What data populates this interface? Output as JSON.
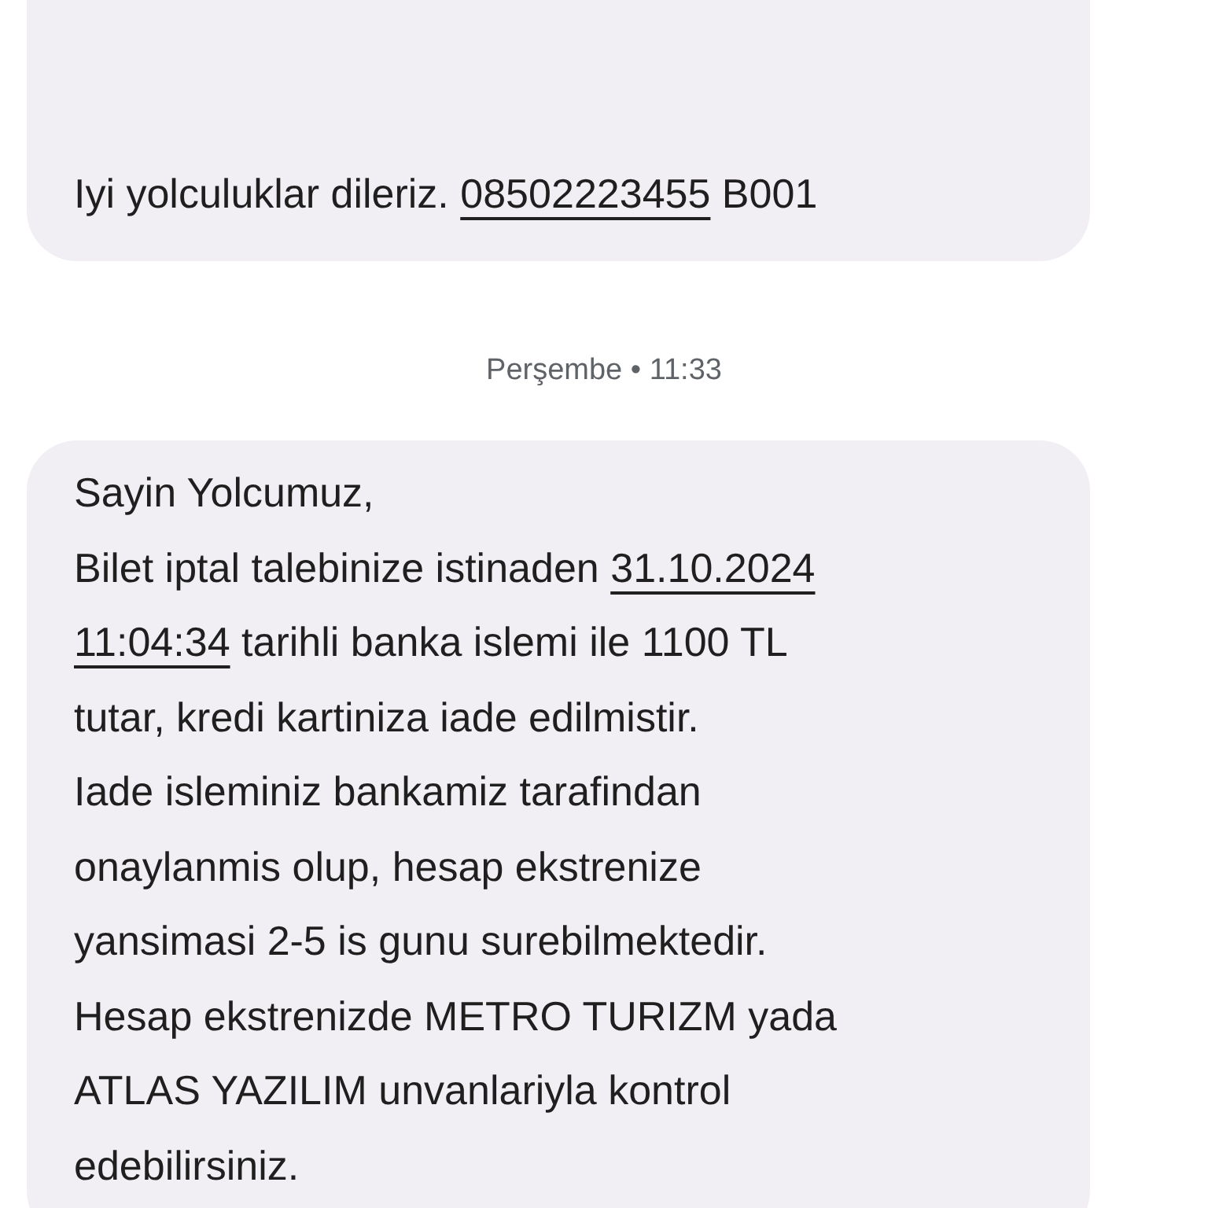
{
  "messages": [
    {
      "lines": [
        [
          {
            "kind": "text",
            "text": "Iyi yolculuklar dileriz. "
          },
          {
            "kind": "phone",
            "text": "08502223455"
          },
          {
            "kind": "text",
            "text": " B001"
          }
        ]
      ]
    },
    {
      "timestamp": "Perşembe • 11:33",
      "lines": [
        [
          {
            "kind": "text",
            "text": "Sayin Yolcumuz,"
          }
        ],
        [
          {
            "kind": "text",
            "text": "Bilet iptal talebinize istinaden "
          },
          {
            "kind": "date",
            "text": "31.10.2024"
          }
        ],
        [
          {
            "kind": "date",
            "text": "11:04:34"
          },
          {
            "kind": "text",
            "text": " tarihli banka islemi ile 1100 TL"
          }
        ],
        [
          {
            "kind": "text",
            "text": "tutar, kredi kartiniza iade edilmistir."
          }
        ],
        [
          {
            "kind": "text",
            "text": "Iade isleminiz bankamiz tarafindan"
          }
        ],
        [
          {
            "kind": "text",
            "text": "onaylanmis olup, hesap ekstrenize"
          }
        ],
        [
          {
            "kind": "text",
            "text": "yansimasi 2-5 is gunu surebilmektedir."
          }
        ],
        [
          {
            "kind": "text",
            "text": "Hesap ekstrenizde METRO TURIZM yada"
          }
        ],
        [
          {
            "kind": "text",
            "text": "ATLAS YAZILIM unvanlariyla kontrol"
          }
        ],
        [
          {
            "kind": "text",
            "text": "edebilirsiniz."
          }
        ]
      ]
    }
  ]
}
